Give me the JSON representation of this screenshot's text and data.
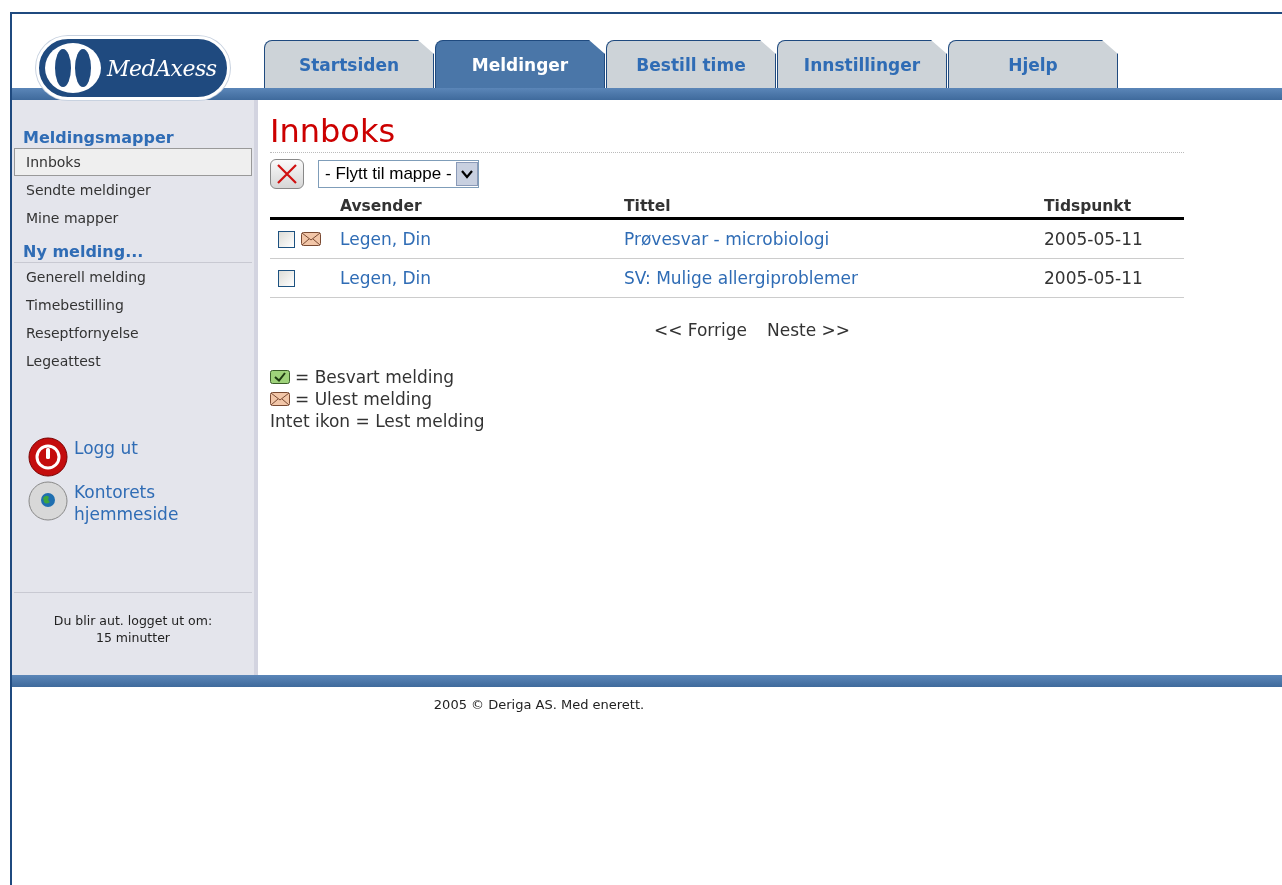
{
  "logo": {
    "text": "MedAxess"
  },
  "tabs": [
    {
      "label": "Startsiden",
      "selected": false
    },
    {
      "label": "Meldinger",
      "selected": true
    },
    {
      "label": "Bestill time",
      "selected": false
    },
    {
      "label": "Innstillinger",
      "selected": false
    },
    {
      "label": "Hjelp",
      "selected": false
    }
  ],
  "sidebar": {
    "sections": [
      {
        "heading": "Meldingsmapper",
        "items": [
          {
            "label": "Innboks",
            "selected": true
          },
          {
            "label": "Sendte meldinger",
            "selected": false
          },
          {
            "label": "Mine mapper",
            "selected": false
          }
        ]
      },
      {
        "heading": "Ny melding...",
        "items": [
          {
            "label": "Generell melding",
            "selected": false
          },
          {
            "label": "Timebestilling",
            "selected": false
          },
          {
            "label": "Reseptfornyelse",
            "selected": false
          },
          {
            "label": "Legeattest",
            "selected": false
          }
        ]
      }
    ],
    "links": [
      {
        "kind": "logout",
        "label": "Logg ut"
      },
      {
        "kind": "homepage",
        "label": "Kontorets hjemmeside"
      }
    ],
    "session": {
      "text": "Du blir aut. logget ut om:",
      "remaining": "15 minutter"
    }
  },
  "main": {
    "title": "Innboks",
    "move_select": {
      "value": "- Flytt til mappe -"
    },
    "columns": [
      "Avsender",
      "Tittel",
      "Tidspunkt"
    ],
    "rows": [
      {
        "checked": false,
        "unread": true,
        "sender": "Legen, Din",
        "title": "Prøvesvar - microbiologi",
        "time": "2005-05-11"
      },
      {
        "checked": false,
        "unread": false,
        "sender": "Legen, Din",
        "title": "SV: Mulige allergiproblemer",
        "time": "2005-05-11"
      }
    ],
    "pager": [
      "<< Forrige",
      "Neste >>"
    ],
    "legend": [
      {
        "kind": "answered",
        "text": "= Besvart melding"
      },
      {
        "kind": "unread",
        "text": "= Ulest melding"
      },
      {
        "kind": "none",
        "text": "Intet ikon = Lest melding"
      }
    ]
  },
  "footer": "2005 © Deriga AS. Med enerett."
}
